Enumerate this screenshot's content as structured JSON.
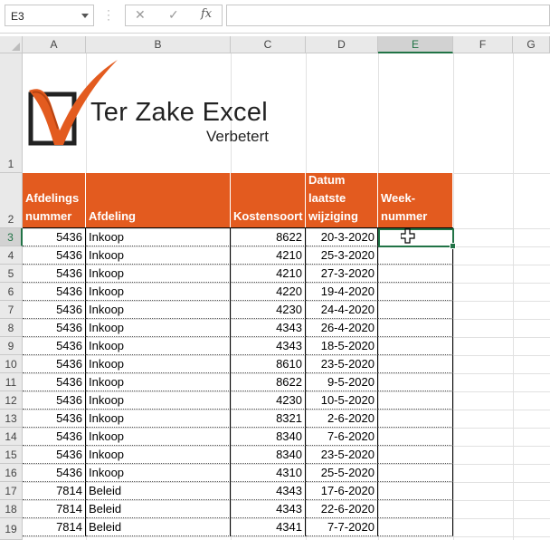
{
  "formula_bar": {
    "name_box": "E3",
    "fx_label": "fx",
    "cancel_symbol": "✕",
    "confirm_symbol": "✓",
    "formula": ""
  },
  "columns": [
    "A",
    "B",
    "C",
    "D",
    "E",
    "F",
    "G"
  ],
  "selected_column": "E",
  "row_numbers": [
    "1",
    "2",
    "3",
    "4",
    "5",
    "6",
    "7",
    "8",
    "9",
    "10",
    "11",
    "12",
    "13",
    "14",
    "15",
    "16",
    "17",
    "18",
    "19"
  ],
  "selected_row": "3",
  "logo": {
    "title": "Ter Zake Excel",
    "subtitle": "Verbetert",
    "accent_color": "#e35b1f"
  },
  "table": {
    "header_color": "#e35b1f",
    "headers": [
      [
        "Afdelings",
        "nummer"
      ],
      [
        "Afdeling"
      ],
      [
        "Kostensoort"
      ],
      [
        "Datum",
        "laatste",
        "wijziging"
      ],
      [
        "Week-",
        "nummer"
      ]
    ],
    "rows": [
      [
        "5436",
        "Inkoop",
        "8622",
        "20-3-2020",
        ""
      ],
      [
        "5436",
        "Inkoop",
        "4210",
        "25-3-2020",
        ""
      ],
      [
        "5436",
        "Inkoop",
        "4210",
        "27-3-2020",
        ""
      ],
      [
        "5436",
        "Inkoop",
        "4220",
        "19-4-2020",
        ""
      ],
      [
        "5436",
        "Inkoop",
        "4230",
        "24-4-2020",
        ""
      ],
      [
        "5436",
        "Inkoop",
        "4343",
        "26-4-2020",
        ""
      ],
      [
        "5436",
        "Inkoop",
        "4343",
        "18-5-2020",
        ""
      ],
      [
        "5436",
        "Inkoop",
        "8610",
        "23-5-2020",
        ""
      ],
      [
        "5436",
        "Inkoop",
        "8622",
        "9-5-2020",
        ""
      ],
      [
        "5436",
        "Inkoop",
        "4230",
        "10-5-2020",
        ""
      ],
      [
        "5436",
        "Inkoop",
        "8321",
        "2-6-2020",
        ""
      ],
      [
        "5436",
        "Inkoop",
        "8340",
        "7-6-2020",
        ""
      ],
      [
        "5436",
        "Inkoop",
        "8340",
        "23-5-2020",
        ""
      ],
      [
        "5436",
        "Inkoop",
        "4310",
        "25-5-2020",
        ""
      ],
      [
        "7814",
        "Beleid",
        "4343",
        "17-6-2020",
        ""
      ],
      [
        "7814",
        "Beleid",
        "4343",
        "22-6-2020",
        ""
      ],
      [
        "7814",
        "Beleid",
        "4341",
        "7-7-2020",
        ""
      ]
    ]
  }
}
